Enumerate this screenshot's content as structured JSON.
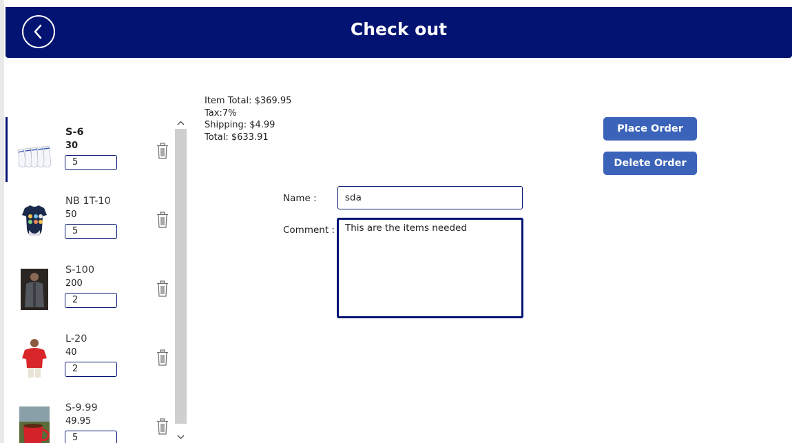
{
  "header": {
    "title": "Check out",
    "back_icon": "chevron-left-circle-icon",
    "background": "#021371"
  },
  "cart": {
    "items": [
      {
        "name": "S-6",
        "price": "30",
        "quantity": "5",
        "thumb": "white-socks"
      },
      {
        "name": "NB 1T-10",
        "price": "50",
        "quantity": "5",
        "thumb": "baby-onesie"
      },
      {
        "name": "S-100",
        "price": "200",
        "quantity": "2",
        "thumb": "man-grey-jacket"
      },
      {
        "name": "L-20",
        "price": "40",
        "quantity": "2",
        "thumb": "red-polo-shirt"
      },
      {
        "name": "S-9.99",
        "price": "49.95",
        "quantity": "5",
        "thumb": "red-coffee-mug"
      }
    ],
    "delete_icon": "trash-icon"
  },
  "totals": {
    "item_total": "Item Total: $369.95",
    "tax": "Tax:7%",
    "shipping": "Shipping: $4.99",
    "total": "Total: $633.91"
  },
  "actions": {
    "place_order": "Place Order",
    "delete_order": "Delete Order",
    "color": "#3b63b9"
  },
  "form": {
    "name_label": "Name :",
    "name_value": "sda",
    "comment_label": "Comment :",
    "comment_value": "This are the items needed"
  }
}
